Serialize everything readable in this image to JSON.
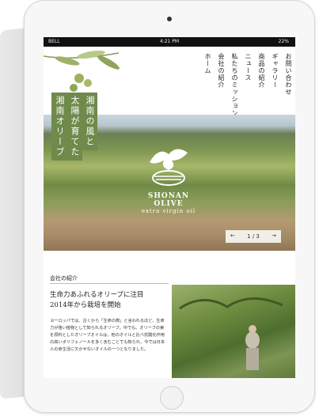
{
  "status_bar": {
    "carrier": "BELL",
    "time": "4:21 PM",
    "battery": "22%"
  },
  "nav": {
    "items": [
      {
        "label": "お問い合わせ"
      },
      {
        "label": "ギャラリー"
      },
      {
        "label": "商品の紹介"
      },
      {
        "label": "ニュース"
      },
      {
        "label": "私たちのミッション"
      },
      {
        "label": "会社の紹介"
      },
      {
        "label": "ホーム"
      }
    ]
  },
  "hero": {
    "tagline": [
      "湘南の風と",
      "太陽が育てた",
      "湘南オリーブ"
    ],
    "logo_name": "SHONAN OLIVE",
    "logo_sub": "extra virgin oil",
    "slider": {
      "prev": "←",
      "count": "1 / 3",
      "next": "→"
    }
  },
  "about": {
    "label": "会社の紹介",
    "headline_1": "生命力あふれるオリーブに注目",
    "headline_2": "2014年から栽培を開始",
    "body": "ヨーロッパでは、古くから「生命の樹」と言われるほど、生命力が強い植物として知られるオリーブ。中でも、オリーブの実を原料としたオリーブオイルは、他のオイルと比べ抗酸化作用の高いポリフェノールを多く含むことでも知られ、今では日本人の食生活に欠かせないオイルの一つとなりました。"
  },
  "colors": {
    "accent_green": "#6f8a4b",
    "status_bar": "#111111"
  }
}
